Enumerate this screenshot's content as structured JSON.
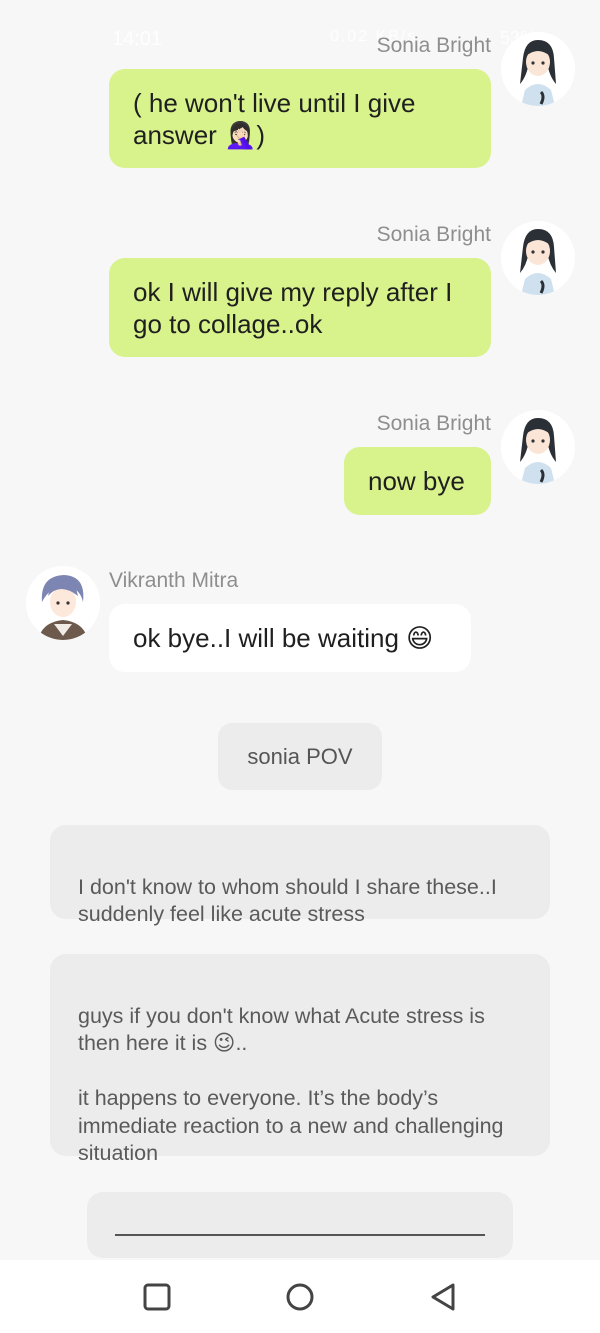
{
  "status_bar": {
    "time": "14:01",
    "indicators": "0.02 KB/s",
    "battery": "53%"
  },
  "messages": [
    {
      "sender": "Sonia Bright",
      "text": "( he won't live until I give answer 🤦🏻‍♀️)",
      "side": "right"
    },
    {
      "sender": "Sonia Bright",
      "text": "ok I will give my reply after I go to collage..ok",
      "side": "right"
    },
    {
      "sender": "Sonia Bright",
      "text": "now bye",
      "side": "right"
    },
    {
      "sender": "Vikranth Mitra",
      "text": "ok bye..I will be waiting 😄",
      "side": "left"
    }
  ],
  "scene_label": "sonia POV",
  "narration": [
    "I don't know to whom should I share these..I  suddenly feel like acute stress",
    "guys if you don't know what Acute stress is  then here it is 😉..\n\nit happens to everyone. It’s the body’s immediate reaction to a new and challenging situation"
  ],
  "input": {
    "value": ""
  },
  "colors": {
    "my_bubble": "#d8f28c",
    "their_bubble": "#ffffff",
    "narration_bg": "#ececec",
    "background": "#f7f7f7"
  },
  "nav": {
    "icons": [
      "square-icon",
      "circle-icon",
      "triangle-back-icon"
    ]
  }
}
